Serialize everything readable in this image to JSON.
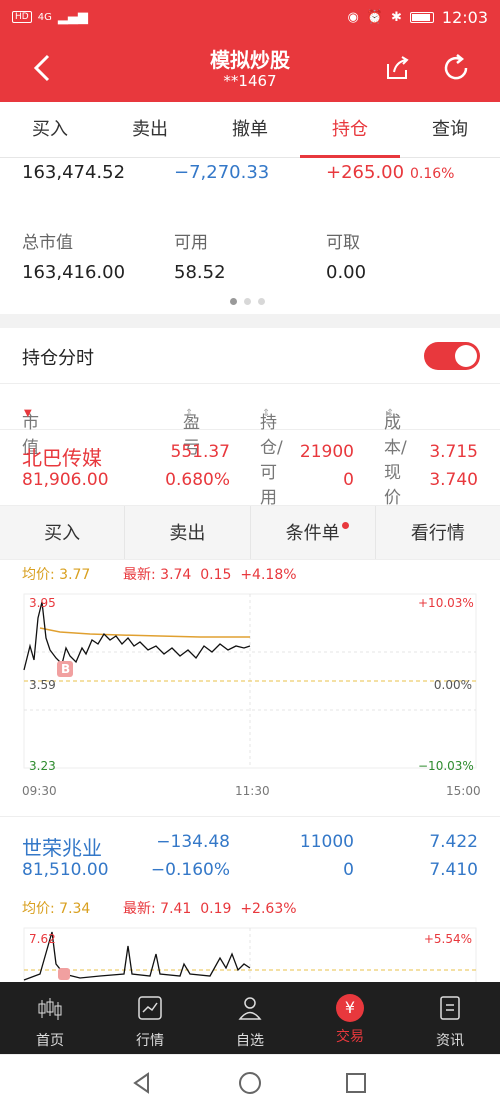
{
  "status": {
    "time": "12:03",
    "network": "4G",
    "hd": "HD"
  },
  "header": {
    "title": "模拟炒股",
    "account": "**1467"
  },
  "tabs": [
    "买入",
    "卖出",
    "撤单",
    "持仓",
    "查询"
  ],
  "summary": {
    "row1": {
      "a": "163,474.52",
      "b": "−7,270.33",
      "c": "+265.00",
      "c_pct": "0.16%"
    },
    "labels": {
      "market_value": "总市值",
      "available": "可用",
      "withdrawable": "可取"
    },
    "market_value": "163,416.00",
    "available": "58.52",
    "withdrawable": "0.00"
  },
  "toggle": {
    "label": "持仓分时",
    "on": true
  },
  "columns": {
    "c1": "市值",
    "c2": "盈亏",
    "c3": "持仓/可用",
    "c4": "成本/现价"
  },
  "positions": [
    {
      "name": "北巴传媒",
      "market_value": "81,906.00",
      "pnl": "551.37",
      "pnl_pct": "0.680%",
      "hold": "21900",
      "avail": "0",
      "cost": "3.715",
      "price": "3.740"
    },
    {
      "name": "世荣兆业",
      "market_value": "81,510.00",
      "pnl": "−134.48",
      "pnl_pct": "−0.160%",
      "hold": "11000",
      "avail": "0",
      "cost": "7.422",
      "price": "7.410"
    }
  ],
  "actions": [
    "买入",
    "卖出",
    "条件单",
    "看行情"
  ],
  "chart1": {
    "avg_label": "均价:",
    "avg": "3.77",
    "last_label": "最新:",
    "last": "3.74",
    "chg": "0.15",
    "chg_pct": "+4.18%",
    "top": "3.95",
    "mid": "3.59",
    "bottom": "3.23",
    "top_pct": "+10.03%",
    "mid_pct": "0.00%",
    "bottom_pct": "−10.03%",
    "t0": "09:30",
    "t1": "11:30",
    "t2": "15:00",
    "marker": "B"
  },
  "chart2": {
    "avg_label": "均价:",
    "avg": "7.34",
    "last_label": "最新:",
    "last": "7.41",
    "chg": "0.19",
    "chg_pct": "+2.63%",
    "top": "7.62",
    "top_pct": "+5.54%"
  },
  "nav": [
    "首页",
    "行情",
    "自选",
    "交易",
    "资讯"
  ],
  "colors": {
    "accent": "#e8383d",
    "down": "#2e8b2e",
    "blue": "#3478c8"
  }
}
